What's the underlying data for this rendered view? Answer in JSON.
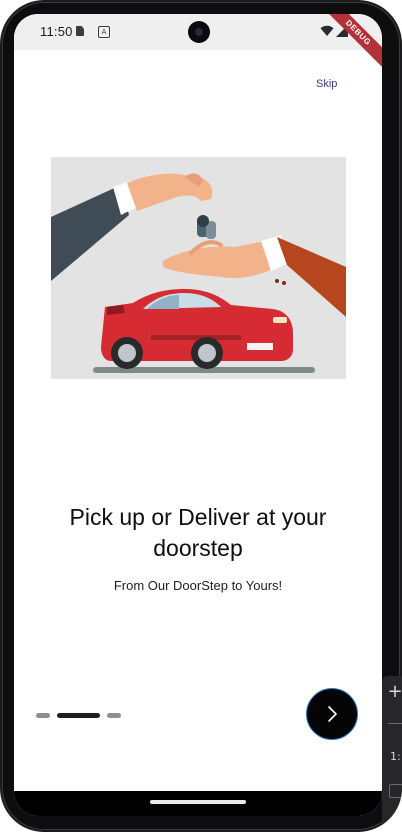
{
  "status_bar": {
    "time": "11:50",
    "debug_label": "DEBUG"
  },
  "skip_label": "Skip",
  "onboarding": {
    "title": "Pick up or Deliver at your doorstep",
    "subtitle": "From Our DoorStep to Yours!",
    "current_page": 2,
    "page_count": 3
  },
  "icons": {
    "next": "chevron-right-icon",
    "a_notification": "A",
    "side_plus": "+",
    "side_text": "1:"
  },
  "colors": {
    "skip": "#3d3a8a",
    "active_dot": "#1e1e1e",
    "inactive_dot": "#8f8f8f",
    "next_button": "#050505",
    "debug_banner": "#b3323a"
  }
}
